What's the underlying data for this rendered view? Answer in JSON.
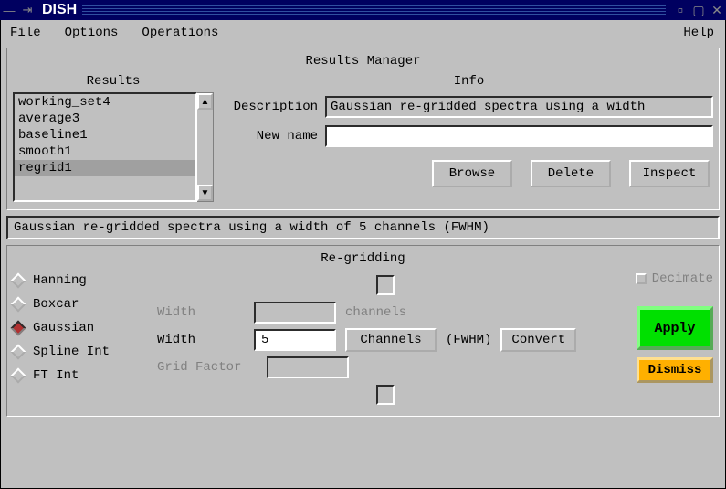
{
  "window": {
    "title": "DISH"
  },
  "menubar": {
    "file": "File",
    "options": "Options",
    "operations": "Operations",
    "help": "Help"
  },
  "results_manager": {
    "title": "Results Manager",
    "results_label": "Results",
    "info_label": "Info",
    "items": [
      "working_set4",
      "average3",
      "baseline1",
      "smooth1",
      "regrid1"
    ],
    "selected_index": 4,
    "description_label": "Description",
    "description_value": "Gaussian re-gridded spectra using a width",
    "newname_label": "New name",
    "newname_value": "",
    "buttons": {
      "browse": "Browse",
      "delete": "Delete",
      "inspect": "Inspect"
    }
  },
  "status": "Gaussian re-gridded spectra using a width of 5 channels (FWHM)",
  "regridding": {
    "title": "Re-gridding",
    "radios": [
      "Hanning",
      "Boxcar",
      "Gaussian",
      "Spline Int",
      "FT Int"
    ],
    "selected_radio": 2,
    "boxcar": {
      "width_label": "Width",
      "width_value": "",
      "unit": "channels"
    },
    "gaussian": {
      "width_label": "Width",
      "width_value": "5",
      "channels_btn": "Channels",
      "fwhm": "(FWHM)",
      "convert_btn": "Convert"
    },
    "spline": {
      "gridfactor_label": "Grid Factor",
      "gridfactor_value": ""
    },
    "decimate_label": "Decimate",
    "apply_btn": "Apply",
    "dismiss_btn": "Dismiss"
  }
}
